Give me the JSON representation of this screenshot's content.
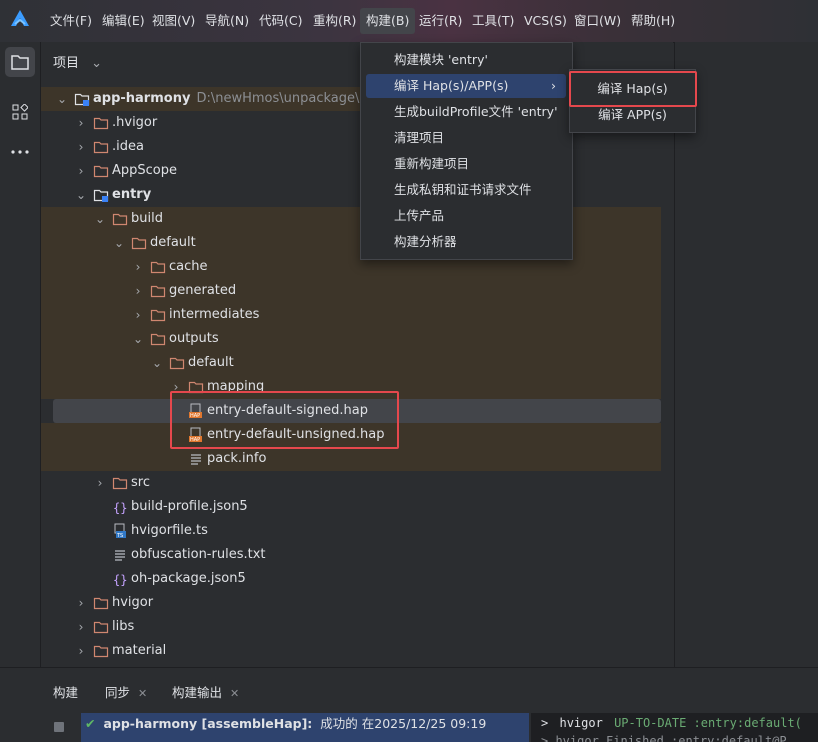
{
  "menubar": {
    "items": [
      "文件(F)",
      "编辑(E)",
      "视图(V)",
      "导航(N)",
      "代码(C)",
      "重构(R)",
      "构建(B)",
      "运行(R)",
      "工具(T)",
      "VCS(S)",
      "窗口(W)",
      "帮助(H)"
    ],
    "active_index": 6
  },
  "project_panel": {
    "title": "项目",
    "tree": [
      {
        "label": "app-harmony",
        "path": "D:\\newHmos\\unpackage\\dist\\c",
        "bold": true
      },
      {
        "label": ".hvigor"
      },
      {
        "label": ".idea"
      },
      {
        "label": "AppScope"
      },
      {
        "label": "entry",
        "bold": true
      },
      {
        "label": "build"
      },
      {
        "label": "default"
      },
      {
        "label": "cache"
      },
      {
        "label": "generated"
      },
      {
        "label": "intermediates"
      },
      {
        "label": "outputs"
      },
      {
        "label": "default"
      },
      {
        "label": "mapping"
      },
      {
        "label": "entry-default-signed.hap"
      },
      {
        "label": "entry-default-unsigned.hap"
      },
      {
        "label": "pack.info"
      },
      {
        "label": "src"
      },
      {
        "label": "build-profile.json5"
      },
      {
        "label": "hvigorfile.ts"
      },
      {
        "label": "obfuscation-rules.txt"
      },
      {
        "label": "oh-package.json5"
      },
      {
        "label": "hvigor"
      },
      {
        "label": "libs"
      },
      {
        "label": "material"
      }
    ]
  },
  "build_menu": {
    "items": [
      "构建模块 'entry'",
      "编译 Hap(s)/APP(s)",
      "生成buildProfile文件 'entry'",
      "清理项目",
      "重新构建项目",
      "生成私钥和证书请求文件",
      "上传产品",
      "构建分析器"
    ],
    "hover_index": 1,
    "submenu": [
      "编译 Hap(s)",
      "编译 APP(s)"
    ]
  },
  "bottom": {
    "tabs": [
      "构建",
      "同步",
      "构建输出"
    ],
    "build_title": "app-harmony [assembleHap]:",
    "build_status": "成功的 在2025/12/25 09:19",
    "console_prompt": ">",
    "console_cmd": "hvigor",
    "console_status": "UP-TO-DATE :entry:default(",
    "console_line2": "> hvigor Finished :entry:default@P"
  },
  "colors": {
    "accent_blue": "#2e436e",
    "highlight_red": "#e5484d",
    "folder": "#d08770",
    "success_green": "#5fb865",
    "console_green": "#6aab73"
  }
}
